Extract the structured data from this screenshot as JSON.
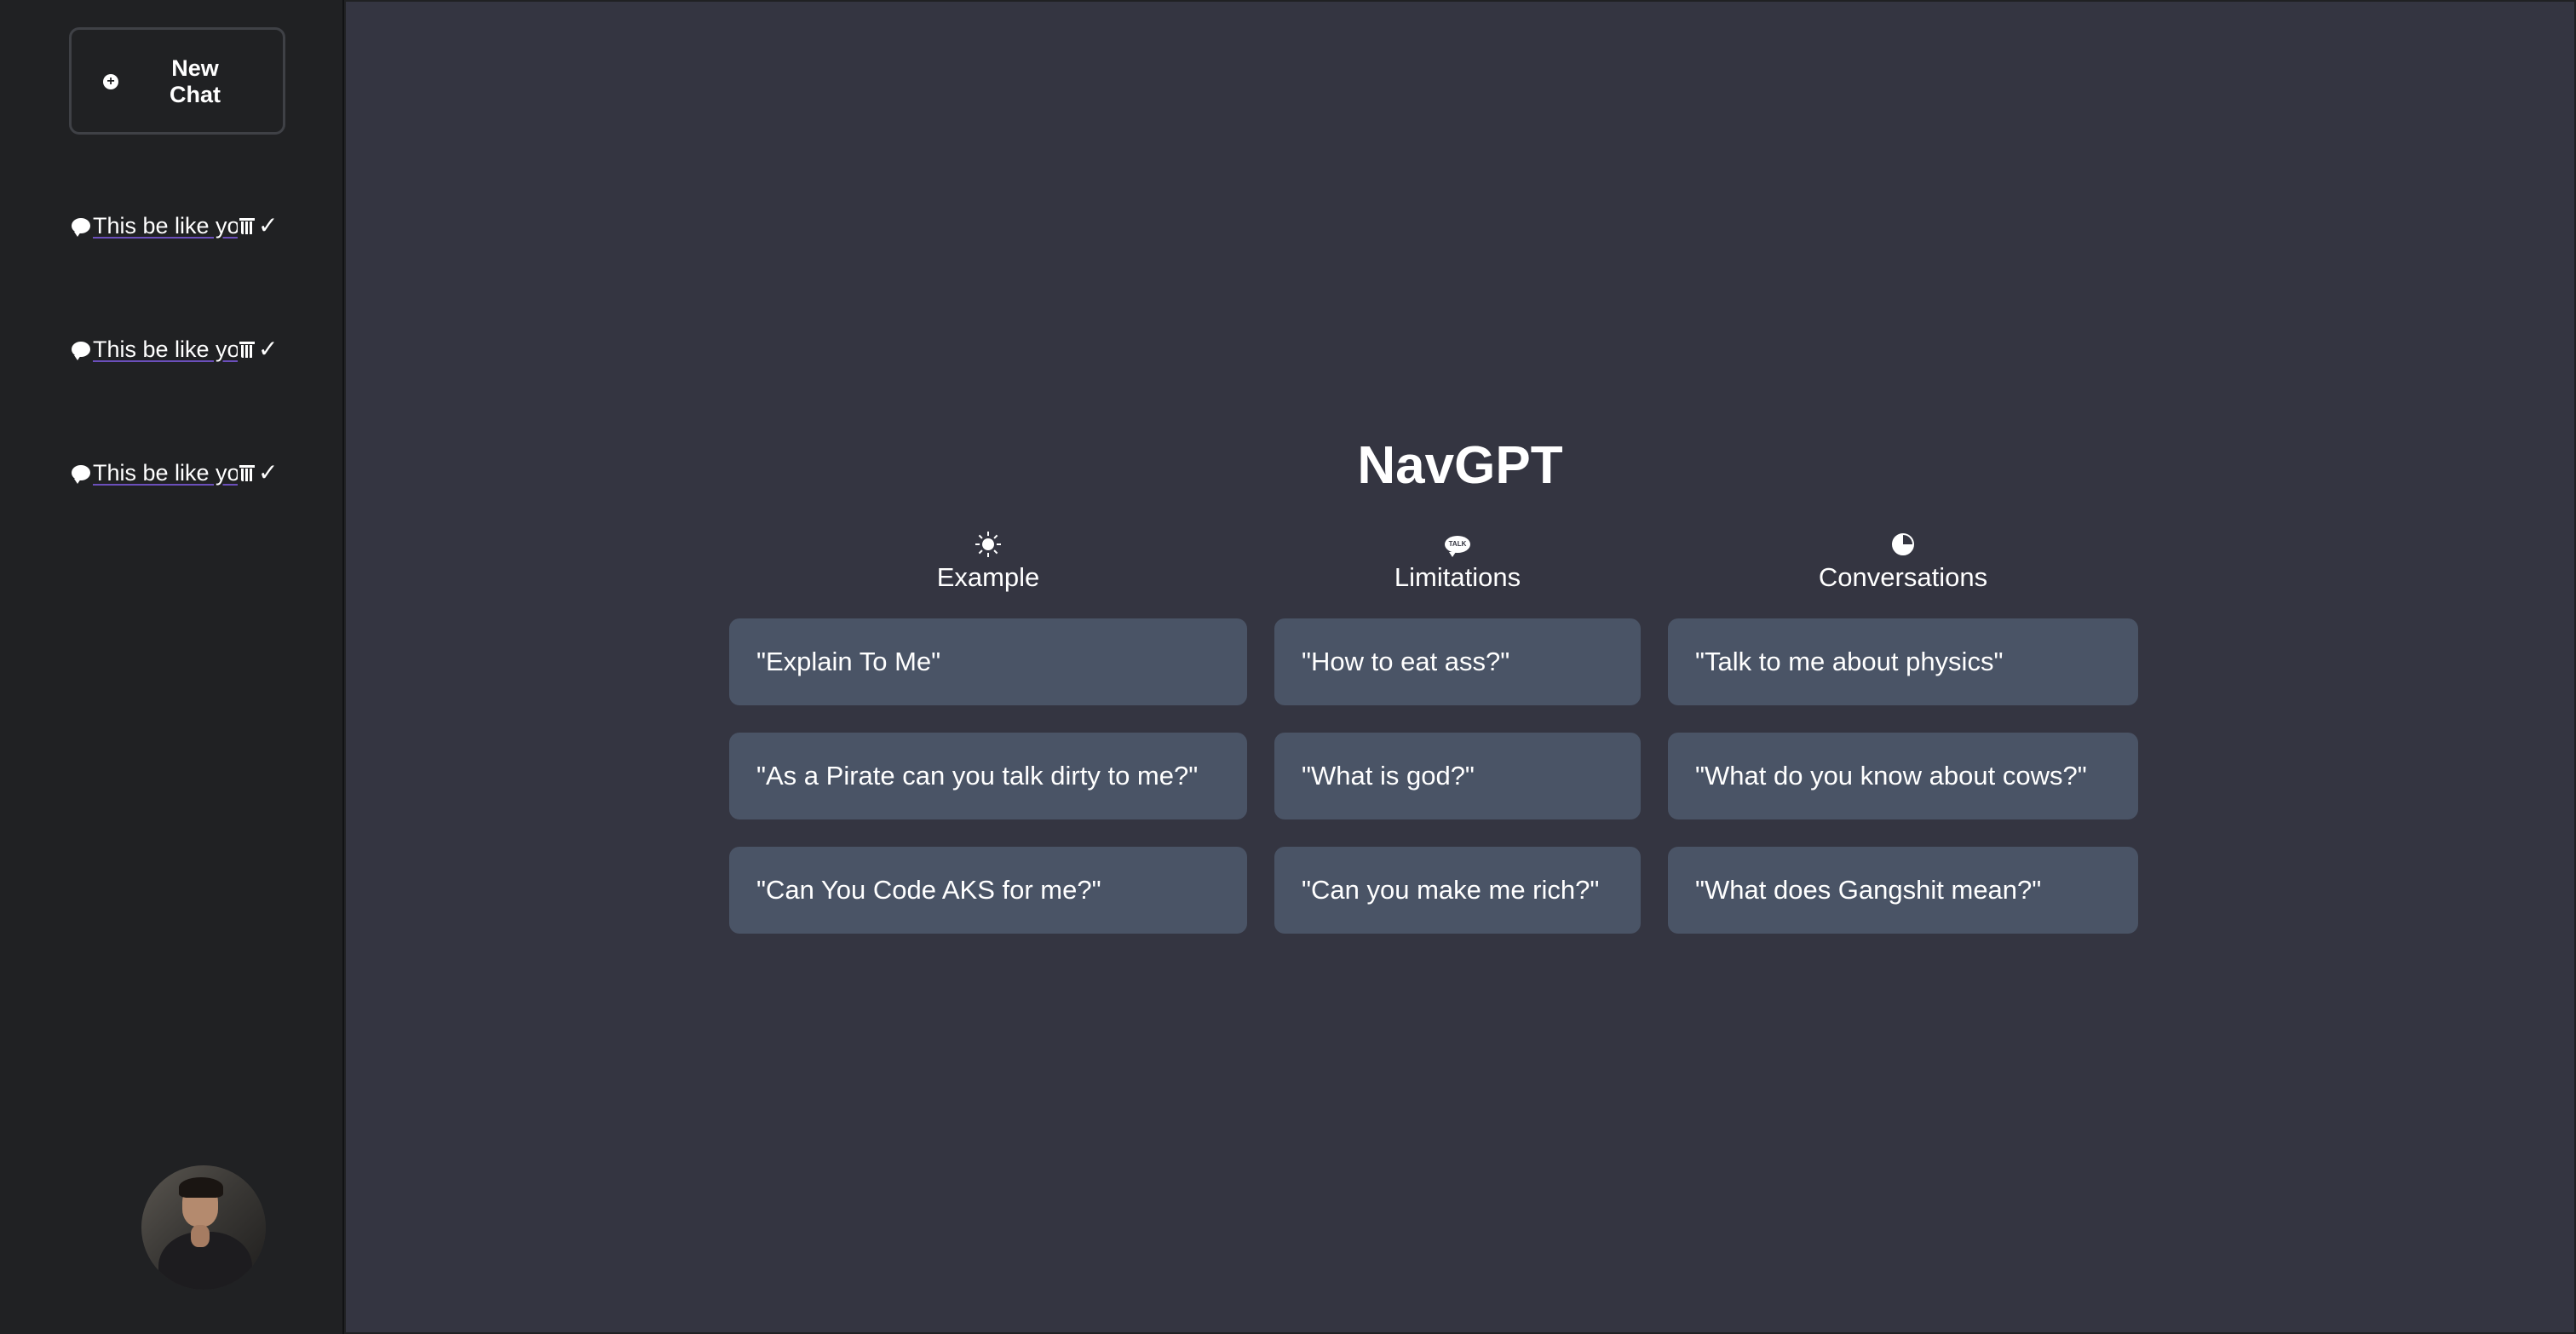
{
  "sidebar": {
    "new_chat_label": "New Chat",
    "chats": [
      {
        "title": "This be like your"
      },
      {
        "title": "This be like your"
      },
      {
        "title": "This be like your"
      }
    ]
  },
  "main": {
    "title": "NavGPT",
    "columns": [
      {
        "label": "Example",
        "icon": "sun-icon",
        "prompts": [
          "\"Explain To Me\"",
          "\"As a Pirate can you talk dirty to me?\"",
          "\"Can You Code AKS for me?\""
        ]
      },
      {
        "label": "Limitations",
        "icon": "talk-bubble-icon",
        "icon_text": "TALK",
        "prompts": [
          "\"How to eat ass?\"",
          "\"What is god?\"",
          "\"Can you make me rich?\""
        ]
      },
      {
        "label": "Conversations",
        "icon": "pie-chart-icon",
        "prompts": [
          "\"Talk to me about physics\"",
          "\"What do you know about cows?\"",
          "\"What does Gangshit mean?\""
        ]
      }
    ]
  },
  "colors": {
    "sidebar_bg": "#202123",
    "main_bg": "#343541",
    "card_bg": "#4a5466",
    "text": "#ffffff"
  }
}
